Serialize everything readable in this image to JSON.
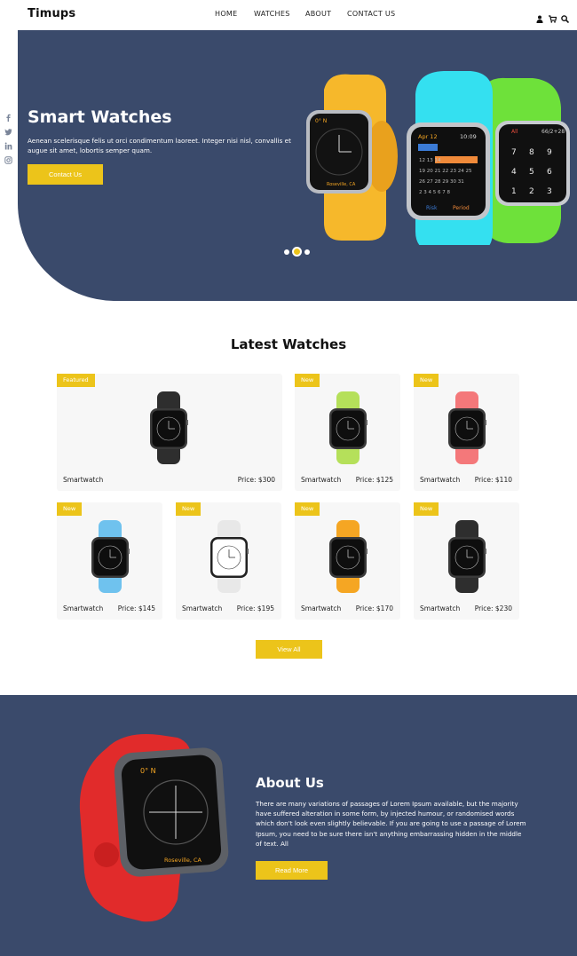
{
  "brand": "Timups",
  "nav": {
    "home": "HOME",
    "watches": "WATCHES",
    "about": "ABOUT",
    "contact": "CONTACT US"
  },
  "header_icons": [
    "user-icon",
    "cart-icon",
    "search-icon"
  ],
  "social_icons": [
    "facebook-icon",
    "twitter-icon",
    "linkedin-icon",
    "instagram-icon"
  ],
  "hero": {
    "title": "Smart Watches",
    "text": "Aenean scelerisque felis ut orci condimentum laoreet. Integer nisi nisl, convallis et augue sit amet, lobortis semper quam.",
    "button": "Contact Us",
    "slides_count": 3,
    "active_slide": 2,
    "watch_faces": {
      "left_top": "0° N",
      "left_bottom": "Roseville, CA",
      "middle_date": "Apr 12",
      "middle_time": "10:09",
      "middle_footer_left": "Risk",
      "middle_footer_right": "Period",
      "right_top_left": "All",
      "right_top_right": "66/2+28"
    }
  },
  "latest": {
    "title": "Latest Watches",
    "items": [
      {
        "badge": "Featured",
        "name": "Smartwatch",
        "price": "Price: $300",
        "band": "#2e2e2e"
      },
      {
        "badge": "New",
        "name": "Smartwatch",
        "price": "Price: $125",
        "band": "#b5e05a"
      },
      {
        "badge": "New",
        "name": "Smartwatch",
        "price": "Price: $110",
        "band": "#f4787a"
      },
      {
        "badge": "New",
        "name": "Smartwatch",
        "price": "Price: $145",
        "band": "#6fc2ee"
      },
      {
        "badge": "New",
        "name": "Smartwatch",
        "price": "Price: $195",
        "band": "#e8e8e8"
      },
      {
        "badge": "New",
        "name": "Smartwatch",
        "price": "Price: $170",
        "band": "#f5a623"
      },
      {
        "badge": "New",
        "name": "Smartwatch",
        "price": "Price: $230",
        "band": "#2e2e2e"
      }
    ],
    "view_all": "View All"
  },
  "about": {
    "title": "About Us",
    "text": "There are many variations of passages of Lorem Ipsum available, but the majority have suffered alteration in some form, by injected humour, or randomised words which don't look even slightly believable. If you are going to use a passage of Lorem Ipsum, you need to be sure there isn't anything embarrassing hidden in the middle of text. All",
    "button": "Read More",
    "watch_top": "0° N",
    "watch_bottom": "Roseville, CA"
  },
  "colors": {
    "navy": "#3a4a6b",
    "accent": "#ecc41a"
  }
}
